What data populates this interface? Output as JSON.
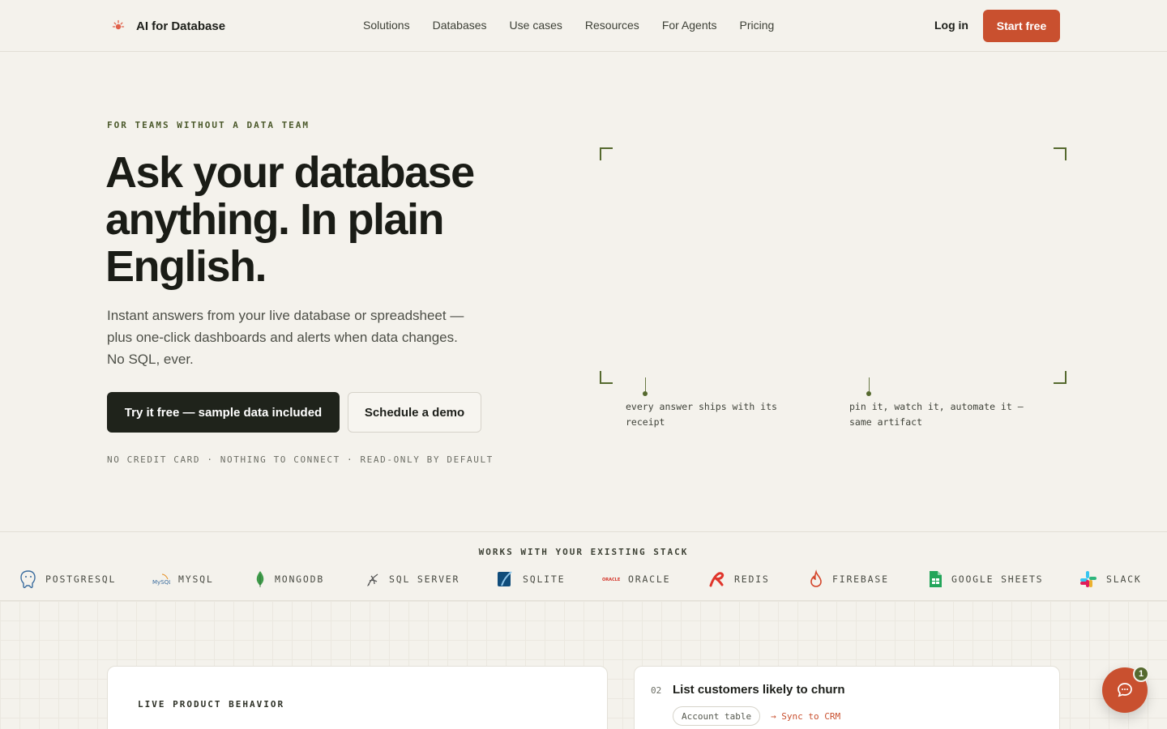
{
  "nav": {
    "brand": "AI for Database",
    "links": [
      "Solutions",
      "Databases",
      "Use cases",
      "Resources",
      "For Agents",
      "Pricing"
    ],
    "login": "Log in",
    "start": "Start free"
  },
  "hero": {
    "eyebrow": "FOR TEAMS WITHOUT A DATA TEAM",
    "title": "Ask your database anything. In plain English.",
    "subtitle": "Instant answers from your live database or spreadsheet — plus one-click dashboards and alerts when data changes. No SQL, ever.",
    "cta_primary": "Try it free — sample data included",
    "cta_secondary": "Schedule a demo",
    "fineprint": "NO CREDIT CARD · NOTHING TO CONNECT · READ-ONLY BY DEFAULT"
  },
  "visual": {
    "annotation_left": "every answer ships with its receipt",
    "annotation_right": "pin it, watch it, automate it — same artifact"
  },
  "stack": {
    "title": "WORKS WITH YOUR EXISTING STACK",
    "items": [
      {
        "label": "POSTGRESQL",
        "icon": "postgresql-icon"
      },
      {
        "label": "MYSQL",
        "icon": "mysql-icon"
      },
      {
        "label": "MONGODB",
        "icon": "mongodb-icon"
      },
      {
        "label": "SQL SERVER",
        "icon": "sql-server-icon"
      },
      {
        "label": "SQLITE",
        "icon": "sqlite-icon"
      },
      {
        "label": "ORACLE",
        "icon": "oracle-icon"
      },
      {
        "label": "REDIS",
        "icon": "redis-icon"
      },
      {
        "label": "FIREBASE",
        "icon": "firebase-icon"
      },
      {
        "label": "GOOGLE SHEETS",
        "icon": "google-sheets-icon"
      },
      {
        "label": "SLACK",
        "icon": "slack-icon"
      }
    ]
  },
  "cards": {
    "left": {
      "kicker": "LIVE PRODUCT BEHAVIOR"
    },
    "right": {
      "num": "02",
      "title": "List customers likely to churn",
      "tag": "Account table",
      "sync": "→ Sync to CRM"
    }
  },
  "chat": {
    "badge": "1"
  },
  "colors": {
    "accent": "#c9502f",
    "olive": "#55692e",
    "background": "#f4f2ec",
    "dark": "#1f231b"
  }
}
